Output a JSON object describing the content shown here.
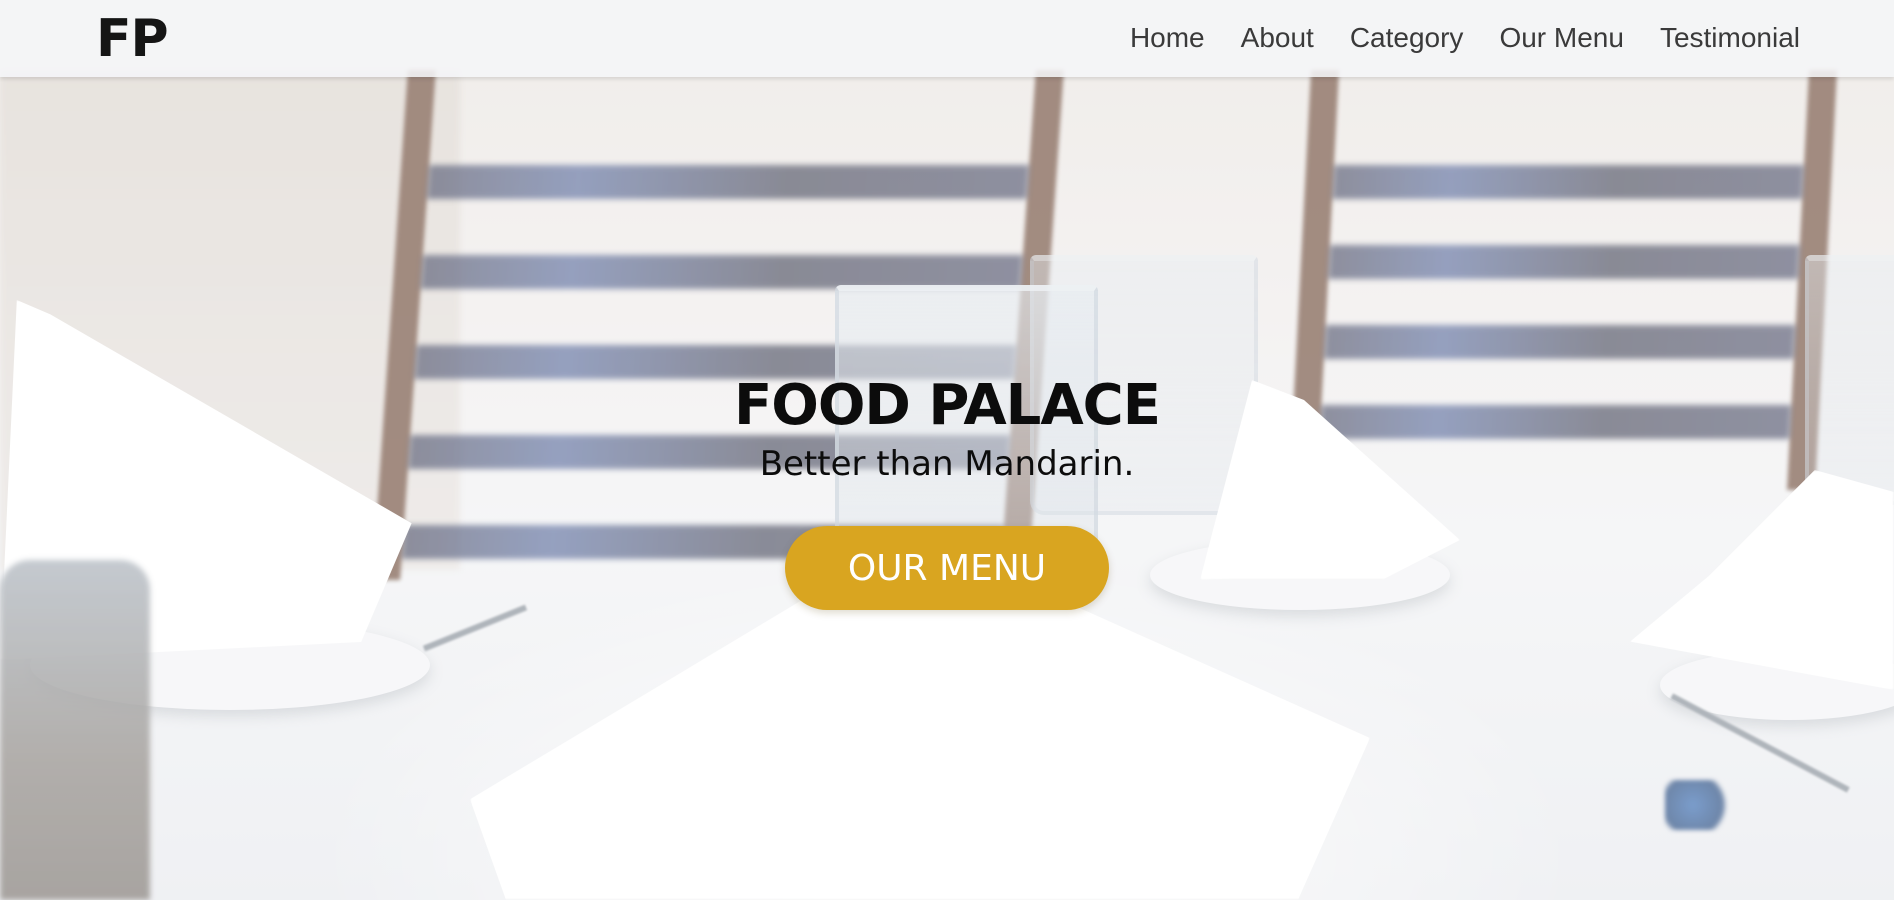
{
  "brand": {
    "logo_text": "FP"
  },
  "nav": {
    "items": [
      {
        "label": "Home"
      },
      {
        "label": "About"
      },
      {
        "label": "Category"
      },
      {
        "label": "Our Menu"
      },
      {
        "label": "Testimonial"
      }
    ]
  },
  "hero": {
    "title": "FOOD PALACE",
    "tagline": "Better than Mandarin.",
    "cta_label": "OUR MENU",
    "background_image": "restaurant-table-setting"
  },
  "colors": {
    "accent": "#d9a520",
    "navbar_bg": "#f5f6f8",
    "text_dark": "#0c0c0c"
  }
}
